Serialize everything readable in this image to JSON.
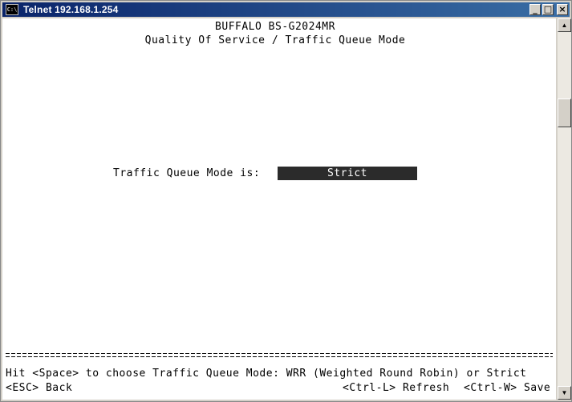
{
  "window": {
    "title": "Telnet 192.168.1.254",
    "icon": "telnet-console-icon",
    "controls": {
      "minimize": "_",
      "maximize": "□",
      "close": "×"
    }
  },
  "terminal": {
    "device": "BUFFALO BS-G2024MR",
    "screen_title": "Quality Of Service / Traffic Queue Mode",
    "field_label": "Traffic Queue Mode is:",
    "field_value": "Strict",
    "divider": "================================================================================",
    "help_line": "Hit <Space> to choose Traffic Queue Mode: WRR (Weighted Round Robin) or Strict",
    "esc_hint": "<ESC> Back",
    "refresh_hint": "<Ctrl-L> Refresh",
    "save_hint": "<Ctrl-W> Save"
  },
  "scrollbar": {
    "up": "▲",
    "down": "▼"
  }
}
